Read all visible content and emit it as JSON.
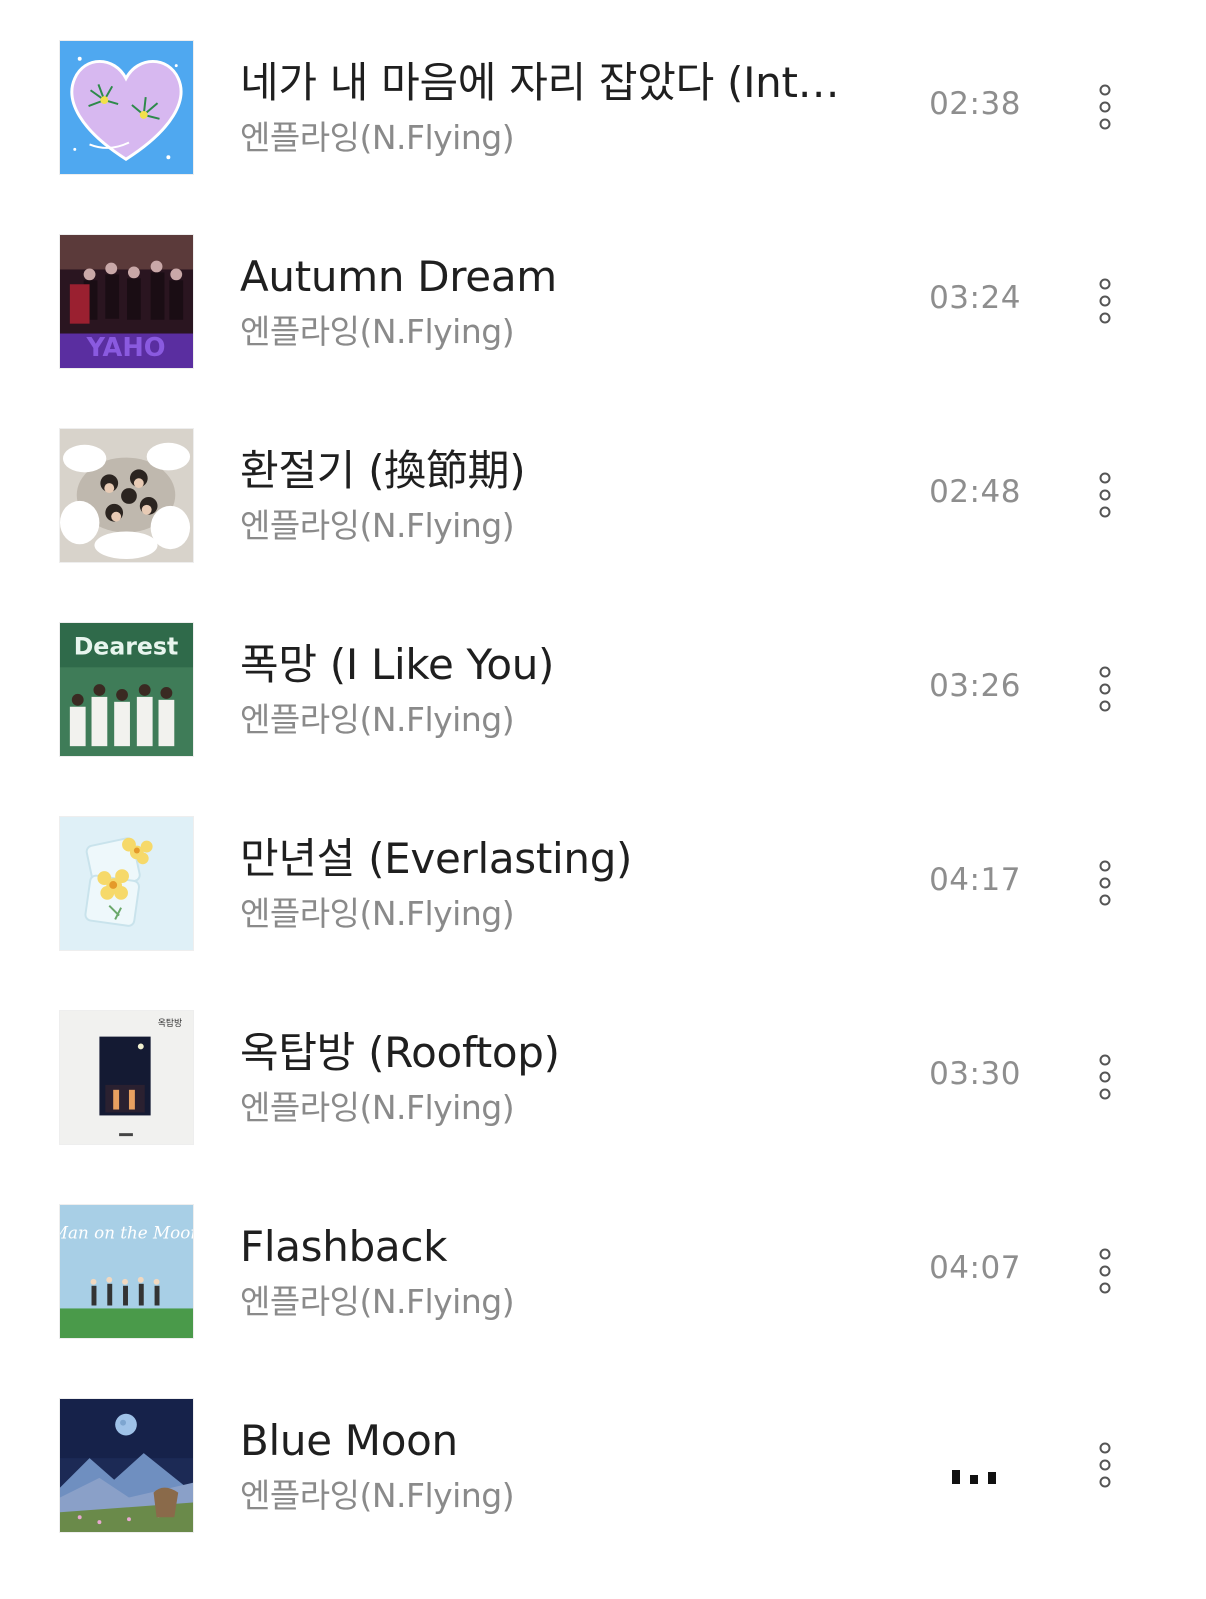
{
  "tracks": [
    {
      "title": "네가 내 마음에 자리 잡았다 (Int…",
      "artist": "엔플라잉(N.Flying)",
      "duration": "02:38",
      "cover_icon": "heart-album-cover-icon",
      "now_playing": false
    },
    {
      "title": "Autumn Dream",
      "artist": "엔플라잉(N.Flying)",
      "duration": "03:24",
      "cover_icon": "yaho-album-cover-icon",
      "cover_text": "YAHO",
      "now_playing": false
    },
    {
      "title": "환절기 (換節期)",
      "artist": "엔플라잉(N.Flying)",
      "duration": "02:48",
      "cover_icon": "band-photo-album-cover-icon",
      "now_playing": false
    },
    {
      "title": "폭망 (I Like You)",
      "artist": "엔플라잉(N.Flying)",
      "duration": "03:26",
      "cover_icon": "dearest-album-cover-icon",
      "cover_text": "Dearest",
      "now_playing": false
    },
    {
      "title": "만년설 (Everlasting)",
      "artist": "엔플라잉(N.Flying)",
      "duration": "04:17",
      "cover_icon": "flower-ice-album-cover-icon",
      "now_playing": false
    },
    {
      "title": "옥탑방 (Rooftop)",
      "artist": "엔플라잉(N.Flying)",
      "duration": "03:30",
      "cover_icon": "rooftop-album-cover-icon",
      "cover_text": "옥탑방",
      "now_playing": false
    },
    {
      "title": "Flashback",
      "artist": "엔플라잉(N.Flying)",
      "duration": "04:07",
      "cover_icon": "man-on-the-moon-album-cover-icon",
      "cover_text": "Man on the Moon",
      "now_playing": false
    },
    {
      "title": "Blue Moon",
      "artist": "엔플라잉(N.Flying)",
      "duration": "",
      "cover_icon": "blue-moon-album-cover-icon",
      "now_playing": true
    }
  ],
  "more_icon": "more-vertical-icon",
  "playing_icon": "equalizer-bars-icon",
  "colors": {
    "title": "#1f1f1f",
    "artist": "#8a8a8a",
    "duration": "#8e8e8e",
    "background": "#ffffff"
  }
}
